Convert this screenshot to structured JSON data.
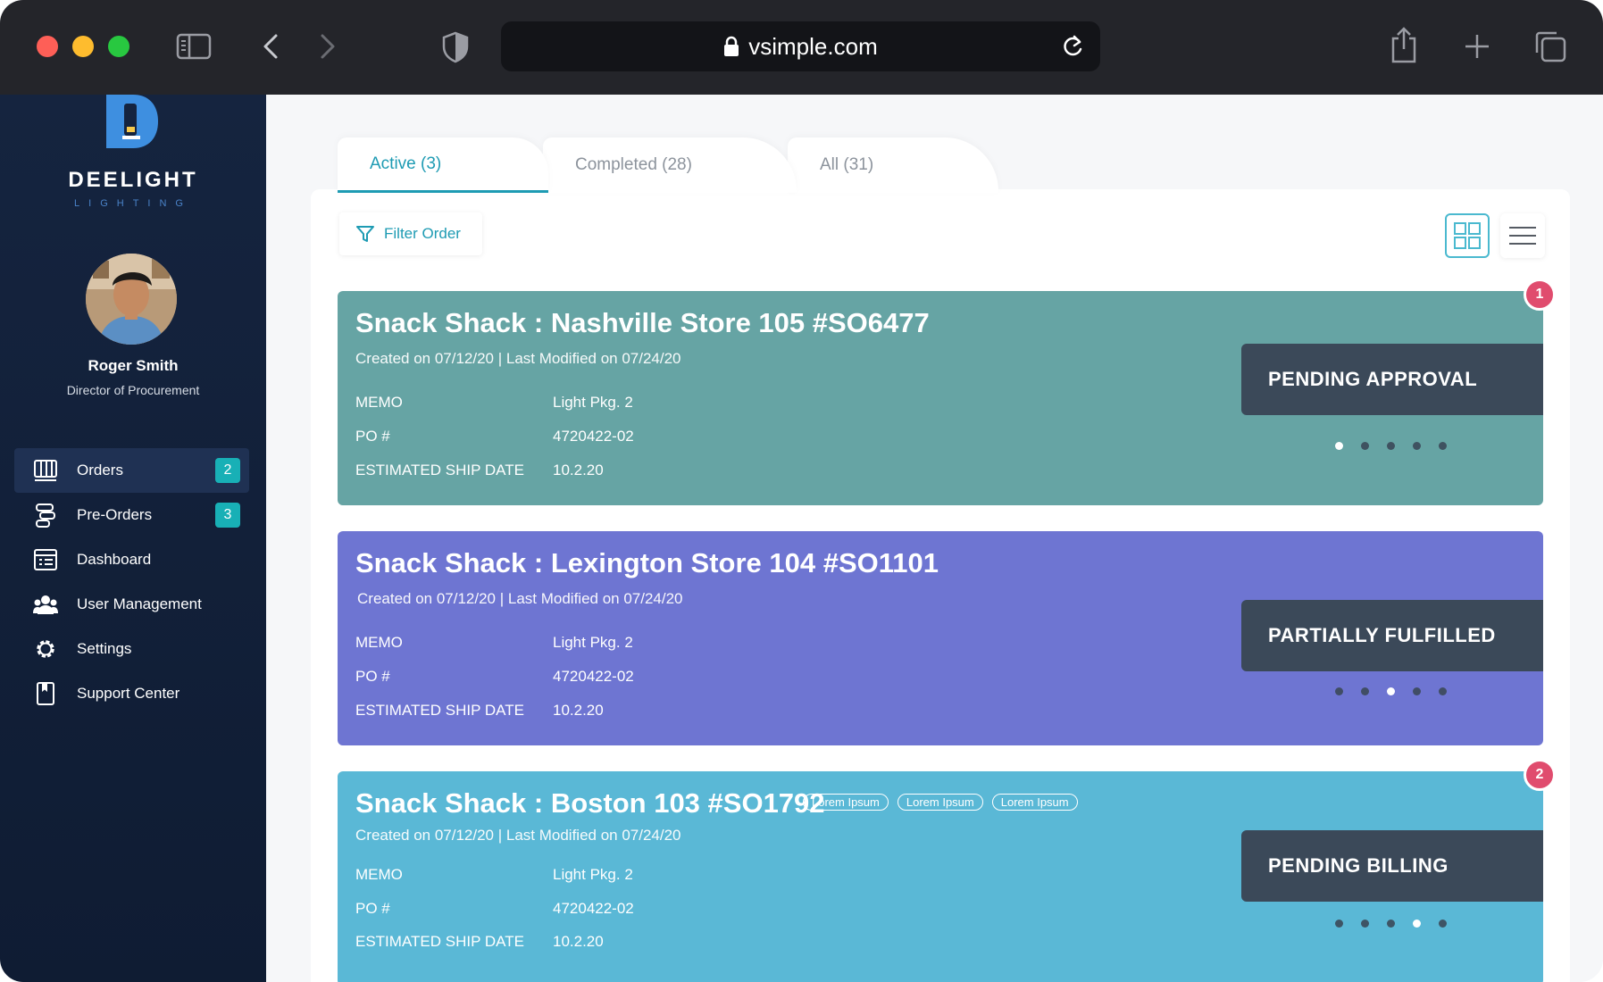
{
  "browser": {
    "url": "vsimple.com"
  },
  "sidebar": {
    "brand": "DEELIGHT",
    "brand_sub": "LIGHTING",
    "user": {
      "name": "Roger Smith",
      "role": "Director of Procurement"
    },
    "items": [
      {
        "label": "Orders",
        "icon": "orders-icon",
        "badge": "2",
        "active": true
      },
      {
        "label": "Pre-Orders",
        "icon": "pre-orders-icon",
        "badge": "3"
      },
      {
        "label": "Dashboard",
        "icon": "dashboard-icon"
      },
      {
        "label": "User Management",
        "icon": "users-icon"
      },
      {
        "label": "Settings",
        "icon": "gear-icon"
      },
      {
        "label": "Support Center",
        "icon": "book-icon"
      }
    ]
  },
  "tabs": [
    {
      "label": "Active (3)",
      "active": true
    },
    {
      "label": "Completed (28)"
    },
    {
      "label": "All (31)"
    }
  ],
  "toolbar": {
    "filter_label": "Filter Order"
  },
  "field_labels": {
    "memo": "MEMO",
    "po": "PO #",
    "ship": "ESTIMATED SHIP DATE"
  },
  "orders": [
    {
      "title": "Snack Shack : Nashville Store 105 #SO6477",
      "meta": "Created on 07/12/20 | Last Modified on 07/24/20",
      "memo": "Light Pkg. 2",
      "po": "4720422-02",
      "ship_date": "10.2.20",
      "status": "PENDING APPROVAL",
      "color": "#66a4a4",
      "active_step": 1,
      "notification": "1"
    },
    {
      "title": "Snack Shack : Lexington Store 104 #SO1101",
      "meta": "Created on 07/12/20 | Last Modified on 07/24/20",
      "memo": "Light Pkg. 2",
      "po": "4720422-02",
      "ship_date": "10.2.20",
      "status": "PARTIALLY FULFILLED",
      "color": "#6e75d2",
      "active_step": 3
    },
    {
      "title": "Snack Shack : Boston 103 #SO1792",
      "meta": "Created on 07/12/20 | Last Modified on 07/24/20",
      "memo": "Light Pkg. 2",
      "po": "4720422-02",
      "ship_date": "10.2.20",
      "status": "PENDING BILLING",
      "color": "#5ab8d6",
      "active_step": 4,
      "notification": "2",
      "tags": [
        "Lorem Ipsum",
        "Lorem Ipsum",
        "Lorem Ipsum"
      ]
    }
  ]
}
